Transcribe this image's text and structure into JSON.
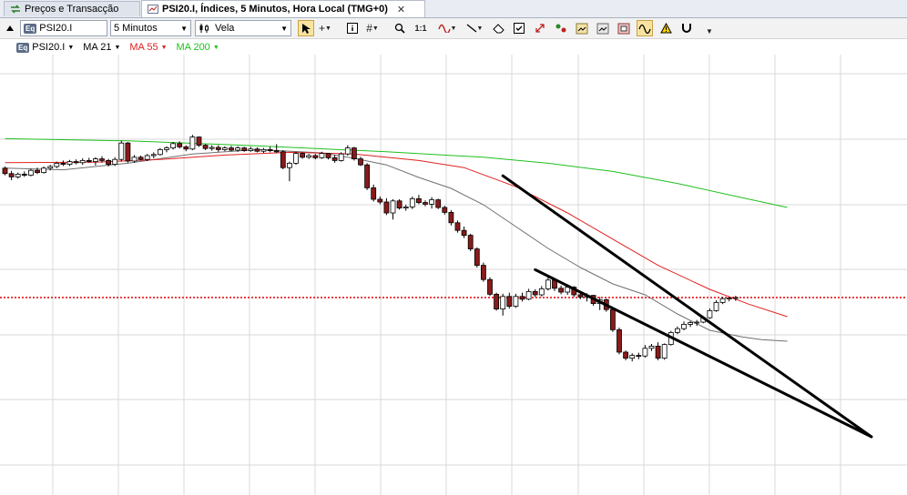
{
  "tabs": [
    {
      "label": "Preços e Transacção",
      "active": false
    },
    {
      "label": "PSI20.I, Índices, 5 Minutos, Hora Local (TMG+0)",
      "active": true
    }
  ],
  "toolbar": {
    "symbol": "PSI20.I",
    "symbol_badge": "Eq",
    "interval": "5 Minutos",
    "chart_style": "Vela",
    "zoom_label": "1:1"
  },
  "legend": {
    "symbol": "PSI20.I",
    "ma21": "MA 21",
    "ma55": "MA 55",
    "ma200": "MA 200"
  },
  "colors": {
    "ma21": "#707070",
    "ma55": "#e02020",
    "ma200": "#1ec01e",
    "up_body": "#ffffff",
    "down_body": "#8b1a1a",
    "price_line": "#e00000",
    "grid": "#d9d9d9",
    "trend": "#000000"
  },
  "chart_data": {
    "type": "candlestick",
    "title": "",
    "xlabel": "",
    "ylabel": "",
    "ylim": [
      0,
      100
    ],
    "grid": true,
    "x": [
      1,
      2,
      3,
      4,
      5,
      6,
      7,
      8,
      9,
      10,
      11,
      12,
      13,
      14,
      15,
      16,
      17,
      18,
      19,
      20,
      21,
      22,
      23,
      24,
      25,
      26,
      27,
      28,
      29,
      30,
      31,
      32,
      33,
      34,
      35,
      36,
      37,
      38,
      39,
      40,
      41,
      42,
      43,
      44,
      45,
      46,
      47,
      48,
      49,
      50,
      51,
      52,
      53,
      54,
      55,
      56,
      57,
      58,
      59,
      60,
      61,
      62,
      63,
      64,
      65,
      66,
      67,
      68,
      69,
      70,
      71,
      72,
      73,
      74,
      75,
      76,
      77,
      78,
      79,
      80,
      81,
      82,
      83,
      84,
      85,
      86,
      87,
      88,
      89,
      90,
      91,
      92,
      93,
      94,
      95,
      96,
      97,
      98,
      99,
      100,
      101,
      102,
      103,
      104,
      105,
      106,
      107,
      108,
      109,
      110,
      111,
      112,
      113,
      114,
      115,
      116,
      117,
      118,
      119,
      120,
      121,
      122
    ],
    "candles": [
      {
        "o": 79.2,
        "h": 79.5,
        "l": 77.9,
        "c": 78.2
      },
      {
        "o": 78.2,
        "h": 78.7,
        "l": 77.0,
        "c": 77.6
      },
      {
        "o": 77.6,
        "h": 78.4,
        "l": 77.3,
        "c": 78.1
      },
      {
        "o": 78.1,
        "h": 78.6,
        "l": 77.6,
        "c": 77.9
      },
      {
        "o": 77.9,
        "h": 79.1,
        "l": 77.7,
        "c": 78.8
      },
      {
        "o": 78.8,
        "h": 79.3,
        "l": 78.1,
        "c": 78.4
      },
      {
        "o": 78.4,
        "h": 79.5,
        "l": 78.2,
        "c": 79.2
      },
      {
        "o": 79.2,
        "h": 79.8,
        "l": 78.8,
        "c": 79.5
      },
      {
        "o": 79.5,
        "h": 80.4,
        "l": 79.2,
        "c": 80.1
      },
      {
        "o": 80.1,
        "h": 80.6,
        "l": 79.6,
        "c": 79.9
      },
      {
        "o": 79.9,
        "h": 80.7,
        "l": 79.6,
        "c": 80.4
      },
      {
        "o": 80.4,
        "h": 80.8,
        "l": 79.9,
        "c": 80.2
      },
      {
        "o": 80.2,
        "h": 81.0,
        "l": 79.8,
        "c": 80.6
      },
      {
        "o": 80.6,
        "h": 81.1,
        "l": 80.2,
        "c": 80.4
      },
      {
        "o": 80.4,
        "h": 81.2,
        "l": 79.7,
        "c": 80.9
      },
      {
        "o": 80.9,
        "h": 81.4,
        "l": 80.2,
        "c": 80.6
      },
      {
        "o": 80.6,
        "h": 80.9,
        "l": 79.5,
        "c": 79.9
      },
      {
        "o": 79.9,
        "h": 81.2,
        "l": 79.6,
        "c": 80.8
      },
      {
        "o": 80.8,
        "h": 84.2,
        "l": 80.4,
        "c": 83.8
      },
      {
        "o": 83.8,
        "h": 84.0,
        "l": 80.2,
        "c": 80.5
      },
      {
        "o": 80.5,
        "h": 81.6,
        "l": 80.2,
        "c": 81.2
      },
      {
        "o": 81.2,
        "h": 81.5,
        "l": 80.6,
        "c": 80.8
      },
      {
        "o": 80.8,
        "h": 81.8,
        "l": 80.5,
        "c": 81.5
      },
      {
        "o": 81.5,
        "h": 82.1,
        "l": 81.0,
        "c": 81.7
      },
      {
        "o": 81.7,
        "h": 82.9,
        "l": 81.5,
        "c": 82.6
      },
      {
        "o": 82.6,
        "h": 83.2,
        "l": 82.1,
        "c": 82.9
      },
      {
        "o": 82.9,
        "h": 84.0,
        "l": 82.6,
        "c": 83.7
      },
      {
        "o": 83.7,
        "h": 84.1,
        "l": 82.8,
        "c": 83.1
      },
      {
        "o": 83.1,
        "h": 83.4,
        "l": 82.3,
        "c": 82.7
      },
      {
        "o": 82.7,
        "h": 85.3,
        "l": 82.5,
        "c": 84.9
      },
      {
        "o": 84.9,
        "h": 85.0,
        "l": 83.1,
        "c": 83.4
      },
      {
        "o": 83.4,
        "h": 83.6,
        "l": 82.5,
        "c": 82.8
      },
      {
        "o": 82.8,
        "h": 83.4,
        "l": 82.4,
        "c": 83.0
      },
      {
        "o": 83.0,
        "h": 83.4,
        "l": 82.2,
        "c": 82.6
      },
      {
        "o": 82.6,
        "h": 83.2,
        "l": 82.3,
        "c": 82.9
      },
      {
        "o": 82.9,
        "h": 83.3,
        "l": 82.3,
        "c": 82.5
      },
      {
        "o": 82.5,
        "h": 83.2,
        "l": 82.2,
        "c": 82.9
      },
      {
        "o": 82.9,
        "h": 83.1,
        "l": 82.2,
        "c": 82.4
      },
      {
        "o": 82.4,
        "h": 83.1,
        "l": 82.2,
        "c": 82.7
      },
      {
        "o": 82.7,
        "h": 83.0,
        "l": 82.1,
        "c": 82.3
      },
      {
        "o": 82.3,
        "h": 82.9,
        "l": 82.0,
        "c": 82.6
      },
      {
        "o": 82.6,
        "h": 83.1,
        "l": 82.1,
        "c": 82.4
      },
      {
        "o": 82.4,
        "h": 83.6,
        "l": 82.0,
        "c": 82.2
      },
      {
        "o": 82.2,
        "h": 82.5,
        "l": 79.0,
        "c": 79.3
      },
      {
        "o": 79.3,
        "h": 80.4,
        "l": 76.8,
        "c": 80.1
      },
      {
        "o": 80.1,
        "h": 82.2,
        "l": 79.8,
        "c": 81.9
      },
      {
        "o": 81.9,
        "h": 82.1,
        "l": 80.9,
        "c": 81.2
      },
      {
        "o": 81.2,
        "h": 81.8,
        "l": 80.9,
        "c": 81.5
      },
      {
        "o": 81.5,
        "h": 81.8,
        "l": 80.8,
        "c": 81.1
      },
      {
        "o": 81.1,
        "h": 82.2,
        "l": 80.9,
        "c": 81.9
      },
      {
        "o": 81.9,
        "h": 82.0,
        "l": 80.8,
        "c": 81.1
      },
      {
        "o": 81.1,
        "h": 81.6,
        "l": 80.2,
        "c": 80.6
      },
      {
        "o": 80.6,
        "h": 82.1,
        "l": 80.4,
        "c": 81.8
      },
      {
        "o": 81.8,
        "h": 83.4,
        "l": 81.5,
        "c": 82.9
      },
      {
        "o": 82.9,
        "h": 83.1,
        "l": 80.6,
        "c": 80.9
      },
      {
        "o": 80.9,
        "h": 81.3,
        "l": 79.6,
        "c": 79.8
      },
      {
        "o": 79.8,
        "h": 80.1,
        "l": 75.2,
        "c": 75.6
      },
      {
        "o": 75.6,
        "h": 76.2,
        "l": 73.1,
        "c": 73.5
      },
      {
        "o": 73.5,
        "h": 74.0,
        "l": 72.6,
        "c": 73.0
      },
      {
        "o": 73.0,
        "h": 73.7,
        "l": 70.6,
        "c": 71.0
      },
      {
        "o": 71.0,
        "h": 73.5,
        "l": 69.8,
        "c": 73.2
      },
      {
        "o": 73.2,
        "h": 73.5,
        "l": 71.6,
        "c": 71.9
      },
      {
        "o": 71.9,
        "h": 72.5,
        "l": 71.4,
        "c": 72.1
      },
      {
        "o": 72.1,
        "h": 74.0,
        "l": 71.7,
        "c": 73.6
      },
      {
        "o": 73.6,
        "h": 74.3,
        "l": 72.6,
        "c": 72.9
      },
      {
        "o": 72.9,
        "h": 73.3,
        "l": 72.2,
        "c": 72.6
      },
      {
        "o": 72.6,
        "h": 73.9,
        "l": 71.8,
        "c": 73.4
      },
      {
        "o": 73.4,
        "h": 73.6,
        "l": 71.7,
        "c": 72.0
      },
      {
        "o": 72.0,
        "h": 72.3,
        "l": 70.7,
        "c": 71.1
      },
      {
        "o": 71.1,
        "h": 71.5,
        "l": 68.7,
        "c": 69.2
      },
      {
        "o": 69.2,
        "h": 69.6,
        "l": 67.4,
        "c": 67.8
      },
      {
        "o": 67.8,
        "h": 68.5,
        "l": 66.4,
        "c": 66.9
      },
      {
        "o": 66.9,
        "h": 67.2,
        "l": 64.0,
        "c": 64.4
      },
      {
        "o": 64.4,
        "h": 64.7,
        "l": 61.0,
        "c": 61.4
      },
      {
        "o": 61.4,
        "h": 61.9,
        "l": 58.4,
        "c": 58.8
      },
      {
        "o": 58.8,
        "h": 59.2,
        "l": 55.8,
        "c": 56.1
      },
      {
        "o": 56.1,
        "h": 56.4,
        "l": 53.1,
        "c": 53.4
      },
      {
        "o": 53.4,
        "h": 56.2,
        "l": 52.2,
        "c": 55.7
      },
      {
        "o": 55.7,
        "h": 56.4,
        "l": 53.5,
        "c": 53.9
      },
      {
        "o": 53.9,
        "h": 56.2,
        "l": 53.6,
        "c": 55.7
      },
      {
        "o": 55.7,
        "h": 56.4,
        "l": 54.8,
        "c": 55.2
      },
      {
        "o": 55.2,
        "h": 57.1,
        "l": 55.0,
        "c": 56.6
      },
      {
        "o": 56.6,
        "h": 57.0,
        "l": 55.6,
        "c": 56.0
      },
      {
        "o": 56.0,
        "h": 57.6,
        "l": 55.7,
        "c": 57.1
      },
      {
        "o": 57.1,
        "h": 59.6,
        "l": 56.8,
        "c": 58.7
      },
      {
        "o": 58.7,
        "h": 59.0,
        "l": 56.7,
        "c": 57.2
      },
      {
        "o": 57.2,
        "h": 57.7,
        "l": 56.1,
        "c": 56.5
      },
      {
        "o": 56.5,
        "h": 57.9,
        "l": 56.0,
        "c": 57.4
      },
      {
        "o": 57.4,
        "h": 57.6,
        "l": 55.6,
        "c": 56.0
      },
      {
        "o": 56.0,
        "h": 56.6,
        "l": 55.2,
        "c": 55.6
      },
      {
        "o": 55.6,
        "h": 56.3,
        "l": 54.8,
        "c": 55.9
      },
      {
        "o": 55.9,
        "h": 56.0,
        "l": 54.0,
        "c": 54.4
      },
      {
        "o": 54.4,
        "h": 55.6,
        "l": 53.2,
        "c": 55.1
      },
      {
        "o": 55.1,
        "h": 55.3,
        "l": 52.9,
        "c": 53.3
      },
      {
        "o": 53.3,
        "h": 53.6,
        "l": 49.2,
        "c": 49.6
      },
      {
        "o": 49.6,
        "h": 50.0,
        "l": 45.1,
        "c": 45.5
      },
      {
        "o": 45.5,
        "h": 45.8,
        "l": 44.0,
        "c": 44.4
      },
      {
        "o": 44.4,
        "h": 45.3,
        "l": 43.8,
        "c": 44.9
      },
      {
        "o": 44.9,
        "h": 45.4,
        "l": 44.2,
        "c": 44.8
      },
      {
        "o": 44.8,
        "h": 46.8,
        "l": 44.5,
        "c": 46.2
      },
      {
        "o": 46.2,
        "h": 47.0,
        "l": 45.7,
        "c": 46.6
      },
      {
        "o": 46.6,
        "h": 47.3,
        "l": 44.0,
        "c": 44.4
      },
      {
        "o": 44.4,
        "h": 47.1,
        "l": 44.1,
        "c": 46.9
      },
      {
        "o": 46.9,
        "h": 49.4,
        "l": 46.7,
        "c": 49.1
      },
      {
        "o": 49.1,
        "h": 50.2,
        "l": 48.8,
        "c": 49.8
      },
      {
        "o": 49.8,
        "h": 51.1,
        "l": 49.5,
        "c": 50.6
      },
      {
        "o": 50.6,
        "h": 51.2,
        "l": 50.1,
        "c": 50.9
      },
      {
        "o": 50.9,
        "h": 51.4,
        "l": 50.3,
        "c": 51.0
      },
      {
        "o": 51.0,
        "h": 52.1,
        "l": 50.8,
        "c": 51.8
      },
      {
        "o": 51.8,
        "h": 53.5,
        "l": 51.6,
        "c": 53.1
      },
      {
        "o": 53.1,
        "h": 55.0,
        "l": 52.9,
        "c": 54.6
      },
      {
        "o": 54.6,
        "h": 55.6,
        "l": 54.3,
        "c": 55.3
      },
      {
        "o": 55.3,
        "h": 55.6,
        "l": 54.8,
        "c": 55.4
      },
      {
        "o": 55.4,
        "h": 55.8,
        "l": 54.9,
        "c": 55.5
      }
    ],
    "series": [
      {
        "key": "ma21",
        "line": [
          [
            1,
            79.2
          ],
          [
            10,
            78.9
          ],
          [
            20,
            80.1
          ],
          [
            30,
            81.8
          ],
          [
            40,
            82.6
          ],
          [
            50,
            82.0
          ],
          [
            55,
            81.0
          ],
          [
            60,
            79.8
          ],
          [
            65,
            77.5
          ],
          [
            70,
            75.5
          ],
          [
            75,
            72.5
          ],
          [
            80,
            68.5
          ],
          [
            85,
            64.5
          ],
          [
            90,
            61.0
          ],
          [
            95,
            58.0
          ],
          [
            100,
            56.0
          ],
          [
            105,
            52.5
          ],
          [
            110,
            49.5
          ],
          [
            115,
            48.3
          ],
          [
            118,
            47.8
          ],
          [
            122,
            47.5
          ]
        ]
      },
      {
        "key": "ma55",
        "line": [
          [
            1,
            80.2
          ],
          [
            15,
            80.3
          ],
          [
            25,
            80.8
          ],
          [
            35,
            81.6
          ],
          [
            45,
            82.1
          ],
          [
            55,
            81.8
          ],
          [
            65,
            80.6
          ],
          [
            72,
            79.3
          ],
          [
            80,
            75.8
          ],
          [
            88,
            71.0
          ],
          [
            95,
            66.2
          ],
          [
            102,
            61.4
          ],
          [
            110,
            57.0
          ],
          [
            116,
            54.3
          ],
          [
            122,
            52.0
          ]
        ]
      },
      {
        "key": "ma200",
        "line": [
          [
            1,
            84.6
          ],
          [
            20,
            84.2
          ],
          [
            40,
            83.3
          ],
          [
            60,
            82.2
          ],
          [
            75,
            81.2
          ],
          [
            85,
            80.1
          ],
          [
            95,
            78.6
          ],
          [
            105,
            76.4
          ],
          [
            115,
            73.8
          ],
          [
            122,
            72.0
          ]
        ]
      }
    ],
    "current_price": 55.5,
    "annotations": [
      {
        "kind": "trendline",
        "from": [
          78,
          77.8
        ],
        "to": [
          135,
          30.0
        ]
      },
      {
        "kind": "trendline",
        "from": [
          83,
          60.6
        ],
        "to": [
          135,
          30.0
        ]
      }
    ]
  }
}
